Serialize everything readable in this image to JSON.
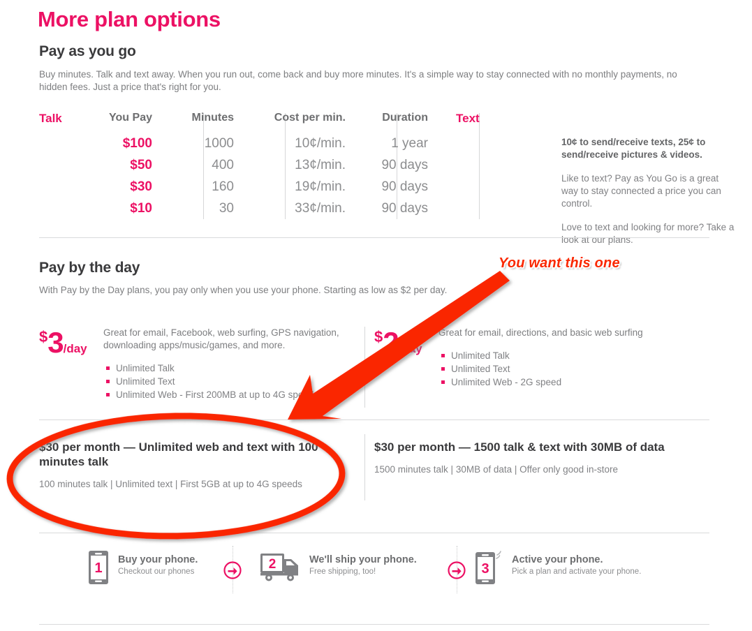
{
  "page": {
    "title": "More plan options"
  },
  "payg": {
    "heading": "Pay as you go",
    "intro": "Buy minutes. Talk and text away. When you run out, come back and buy more minutes. It's a simple way to stay connected with no monthly payments, no hidden fees. Just a price that's right for you.",
    "table": {
      "headers": {
        "talk": "Talk",
        "you_pay": "You Pay",
        "minutes": "Minutes",
        "cost_per_min": "Cost per min.",
        "duration": "Duration",
        "text": "Text"
      },
      "rows": [
        {
          "you_pay": "$100",
          "minutes": "1000",
          "cost_per_min": "10¢/min.",
          "duration": "1 year"
        },
        {
          "you_pay": "$50",
          "minutes": "400",
          "cost_per_min": "13¢/min.",
          "duration": "90 days"
        },
        {
          "you_pay": "$30",
          "minutes": "160",
          "cost_per_min": "19¢/min.",
          "duration": "90 days"
        },
        {
          "you_pay": "$10",
          "minutes": "30",
          "cost_per_min": "33¢/min.",
          "duration": "90 days"
        }
      ]
    },
    "text_column": {
      "rates": "10¢ to send/receive texts, 25¢ to send/receive pictures & videos.",
      "paragraph_1": "Like to text? Pay as You Go is a great way to stay connected a price you can control.",
      "paragraph_2": "Love to text and looking for more? Take a look at our plans."
    }
  },
  "pay_by_day": {
    "heading": "Pay by the day",
    "intro": "With Pay by the Day plans, you pay only when you use your phone. Starting as low as $2 per day.",
    "plans": [
      {
        "dollar": "$",
        "amount": "3",
        "per": "/day",
        "description": "Great for email, Facebook, web surfing, GPS navigation, downloading apps/music/games, and more.",
        "features": [
          "Unlimited Talk",
          "Unlimited Text",
          "Unlimited Web - First 200MB at up to 4G speeds"
        ]
      },
      {
        "dollar": "$",
        "amount": "2",
        "per": "/day",
        "description": "Great for email, directions, and basic web surfing",
        "features": [
          "Unlimited Talk",
          "Unlimited Text",
          "Unlimited Web - 2G speed"
        ]
      }
    ]
  },
  "monthly_plans": [
    {
      "title": "$30 per month — Unlimited web and text with 100 minutes talk",
      "details": "100 minutes talk | Unlimited text | First 5GB at up to 4G speeds"
    },
    {
      "title": "$30 per month — 1500 talk & text with 30MB of data",
      "details": "1500 minutes talk | 30MB of data | Offer only good in-store"
    }
  ],
  "steps": [
    {
      "number": "1",
      "heading": "Buy your phone.",
      "subtext": "Checkout our phones",
      "icon": "phone-icon"
    },
    {
      "number": "2",
      "heading": "We'll ship your phone.",
      "subtext": "Free shipping, too!",
      "icon": "truck-icon"
    },
    {
      "number": "3",
      "heading": "Active your phone.",
      "subtext": "Pick a plan and activate your phone.",
      "icon": "phone-signal-icon"
    }
  ],
  "step_separators": [
    {
      "icon": "arrow-right-circle-icon"
    },
    {
      "icon": "arrow-right-circle-icon"
    }
  ],
  "annotation": {
    "label": "You want this one",
    "arrow_icon": "red-arrow-icon",
    "highlight_icon": "red-ellipse-icon",
    "color": "#fa2800"
  },
  "colors": {
    "brand_pink": "#ec1164",
    "annotation_red": "#fa2800",
    "body_text": "#7d7e80",
    "heading_text": "#3a3a3c",
    "rule": "#d9dadb"
  }
}
